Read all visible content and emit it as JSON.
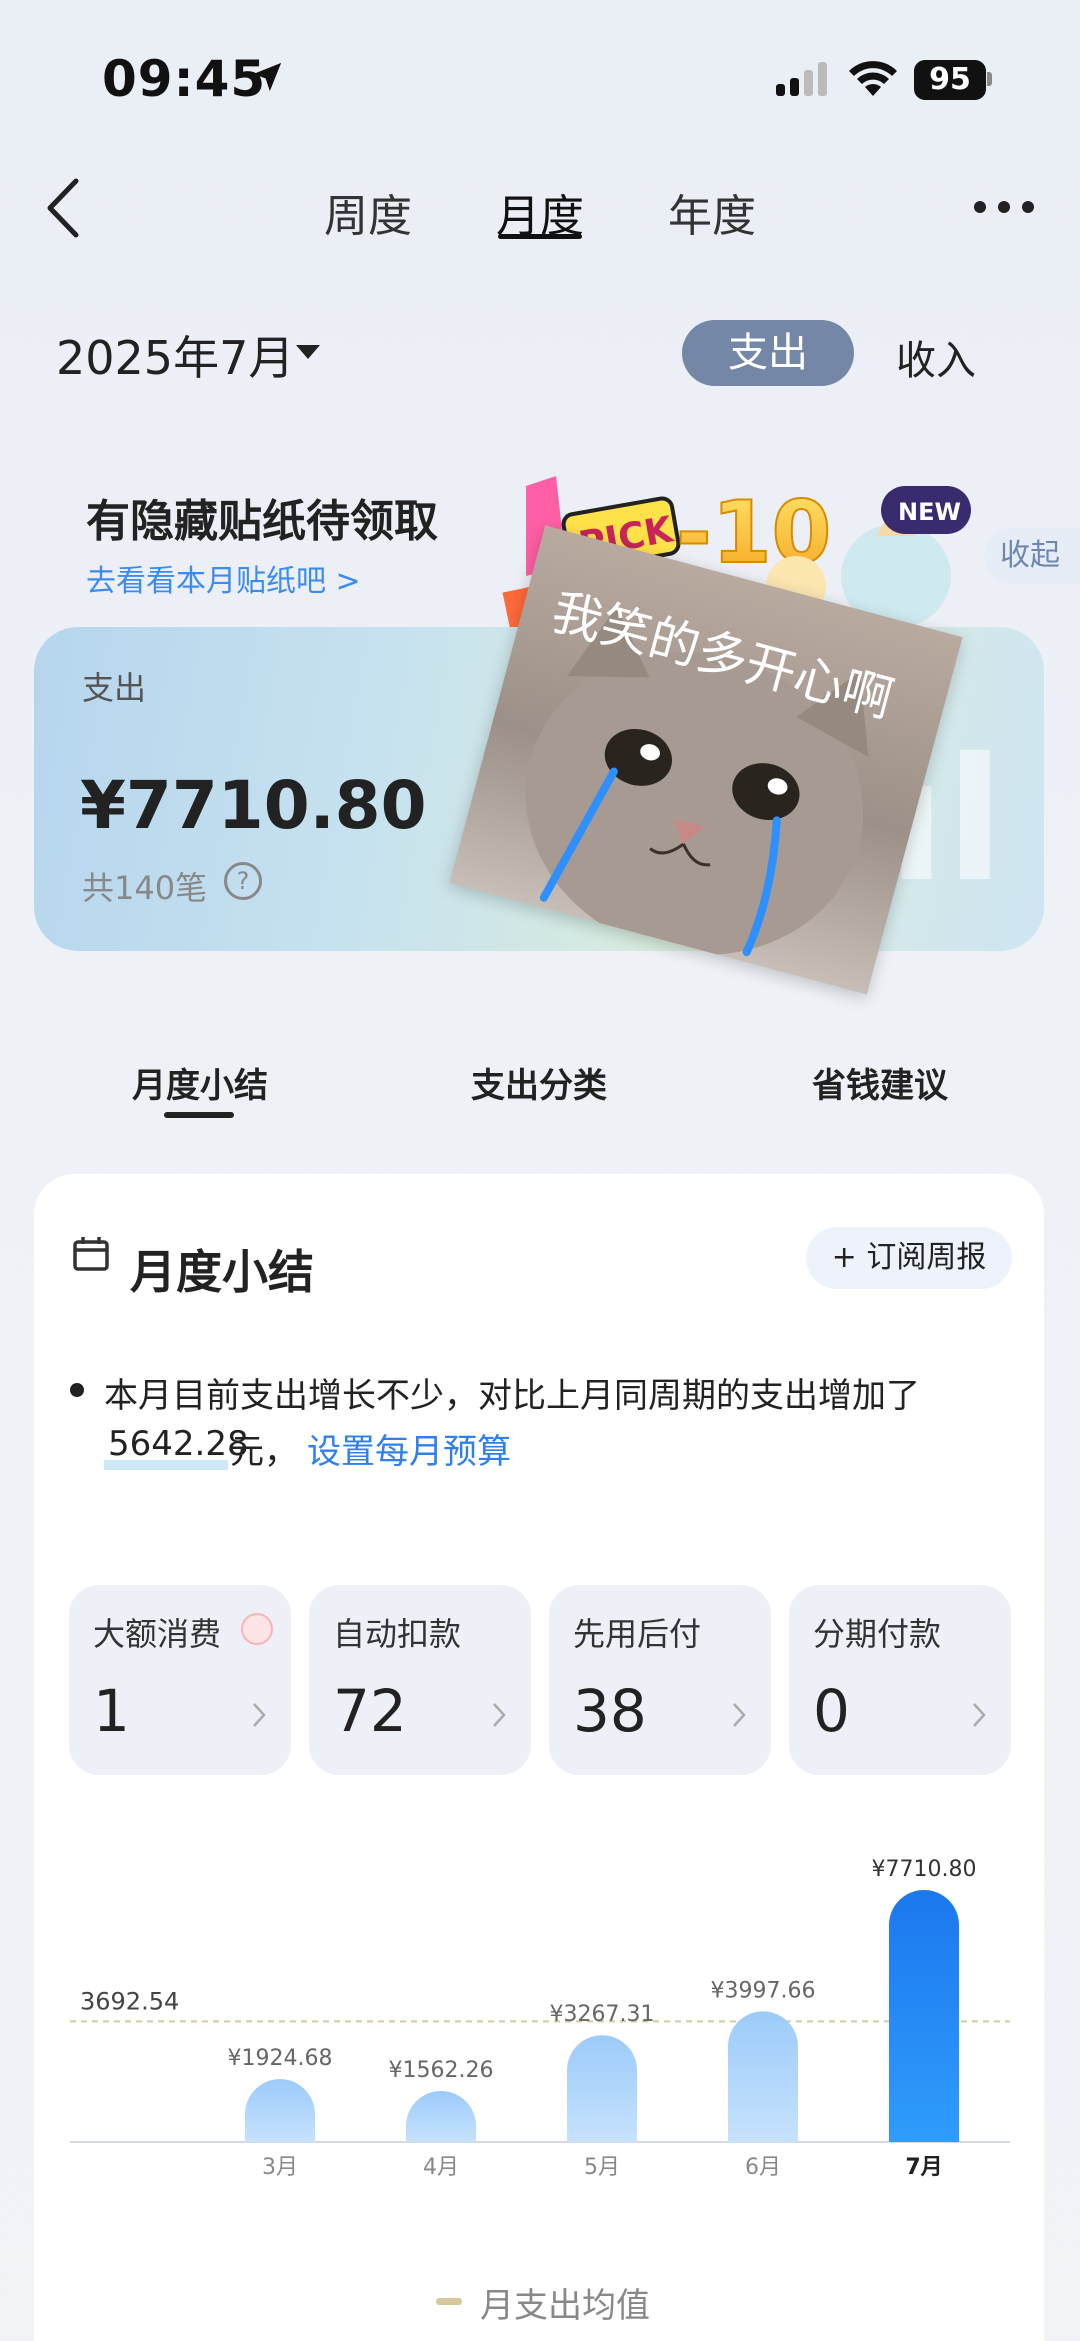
{
  "status_bar": {
    "time": "09:45",
    "battery": "95"
  },
  "top_tabs": [
    "周度",
    "月度",
    "年度"
  ],
  "active_tab_index": 1,
  "month_selector": {
    "value": "2025年7月"
  },
  "type_toggle": {
    "expense": "支出",
    "income": "收入",
    "active": "expense"
  },
  "sticker_banner": {
    "title": "有隐藏贴纸待领取",
    "link": "去看看本月贴纸吧 >",
    "collapse": "收起",
    "art_text": {
      "pick": "PICK",
      "discount": "-10",
      "new": "NEW"
    }
  },
  "summary_card": {
    "label": "支出",
    "amount": "¥7710.80",
    "count": "共140笔",
    "help": "?",
    "bg_letters": "ul"
  },
  "cat_sticker": {
    "caption": "我笑的多开心啊"
  },
  "section_tabs": [
    "月度小结",
    "支出分类",
    "省钱建议"
  ],
  "monthly_summary": {
    "title": "月度小结",
    "subscribe_button": "+ 订阅周报",
    "text_line1": "本月目前支出增长不少，对比上月同周期的支出增加了",
    "amount": "5642.28",
    "suffix": "元，",
    "budget_link": "设置每月预算"
  },
  "stat_tiles": [
    {
      "label": "大额消费",
      "value": "1",
      "has_badge": true
    },
    {
      "label": "自动扣款",
      "value": "72",
      "has_badge": false
    },
    {
      "label": "先用后付",
      "value": "38",
      "has_badge": false
    },
    {
      "label": "分期付款",
      "value": "0",
      "has_badge": false
    }
  ],
  "chart_data": {
    "type": "bar",
    "categories": [
      "3月",
      "4月",
      "5月",
      "6月",
      "7月"
    ],
    "values": [
      1924.68,
      1562.26,
      3267.31,
      3997.66,
      7710.8
    ],
    "value_labels": [
      "¥1924.68",
      "¥1562.26",
      "¥3267.31",
      "¥3997.66",
      "¥7710.80"
    ],
    "average": 3692.54,
    "average_label": "3692.54",
    "highlight_index": 4,
    "legend": "月支出均值",
    "colors": {
      "bar": "#a8d2fb",
      "bar_highlight": "#1e7ff0",
      "average_line": "#d8c8a0"
    }
  }
}
